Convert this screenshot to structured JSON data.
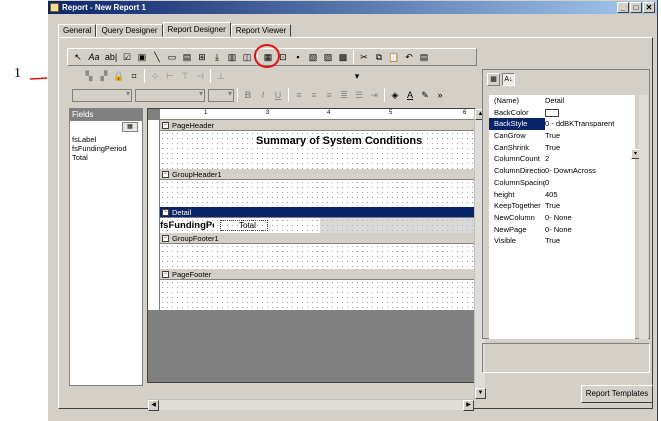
{
  "callout": {
    "number": "1"
  },
  "window": {
    "title": "Report - New Report 1",
    "controls": {
      "minimize": "_",
      "maximize": "□",
      "close": "✕"
    }
  },
  "tabs": [
    {
      "label": "General",
      "active": false
    },
    {
      "label": "Query Designer",
      "active": false
    },
    {
      "label": "Report Designer",
      "active": true
    },
    {
      "label": "Report Viewer",
      "active": false
    }
  ],
  "toolbar": {
    "label_tool": "Aa",
    "textbox_tool": "ab|"
  },
  "fields_panel": {
    "header": "Fields",
    "items": [
      "fsLabel",
      "fsFundingPeriod",
      "Total"
    ]
  },
  "designer": {
    "ruler_marks": [
      "1",
      "2",
      "3",
      "4",
      "5",
      "6"
    ],
    "bands": {
      "page_header": "PageHeader",
      "group_header": "GroupHeader1",
      "detail": "Detail",
      "group_footer": "GroupFooter1",
      "page_footer": "PageFooter"
    },
    "report_title": "Summary of System Conditions",
    "detail_field_1": "fsFundingPe",
    "detail_field_2": "Total"
  },
  "properties": {
    "rows": [
      {
        "name": "(Name)",
        "value": "Detail"
      },
      {
        "name": "BackColor",
        "value": ""
      },
      {
        "name": "BackStyle",
        "value": "0 - ddBKTransparent"
      },
      {
        "name": "CanGrow",
        "value": "True"
      },
      {
        "name": "CanShrink",
        "value": "True"
      },
      {
        "name": "ColumnCount",
        "value": "2"
      },
      {
        "name": "ColumnDirectio",
        "value": "0- DownAcross"
      },
      {
        "name": "ColumnSpacing",
        "value": "0"
      },
      {
        "name": "height",
        "value": "405"
      },
      {
        "name": "KeepTogether",
        "value": "True"
      },
      {
        "name": "NewColumn",
        "value": "0- None"
      },
      {
        "name": "NewPage",
        "value": "0- None"
      },
      {
        "name": "Visible",
        "value": "True"
      }
    ],
    "selected_row": "BackStyle"
  },
  "buttons": {
    "report_templates": "Report Templates"
  },
  "colors": {
    "titlebar_start": "#0a246a",
    "titlebar_end": "#a6caf0",
    "selection": "#0a246a",
    "face": "#d4d0c8",
    "callout_circle": "#e01010"
  }
}
